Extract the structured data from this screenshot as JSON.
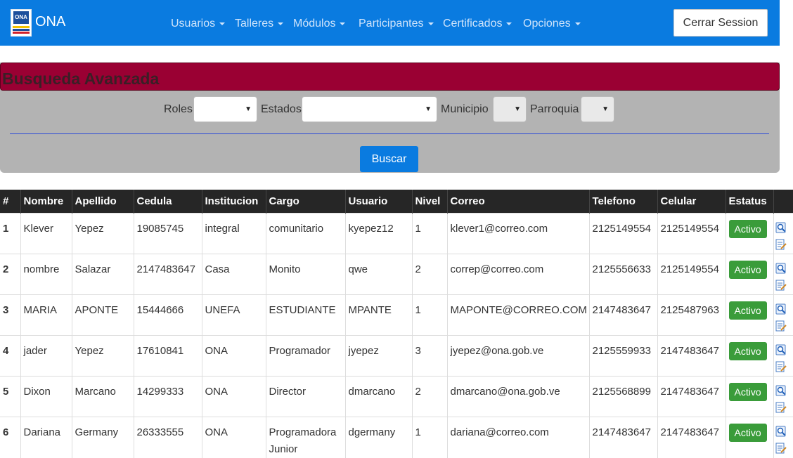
{
  "navbar": {
    "brand": "ONA",
    "logo_text": "ONA",
    "menu": [
      {
        "label": "Usuarios"
      },
      {
        "label": "Talleres"
      },
      {
        "label": "Módulos"
      },
      {
        "label": "Participantes"
      },
      {
        "label": "Certificados"
      },
      {
        "label": "Opciones"
      }
    ],
    "logout_label": "Cerrar Session"
  },
  "search": {
    "title": "Busqueda Avanzada",
    "filters": {
      "roles": "Roles",
      "estados": "Estados",
      "municipio": "Municipio",
      "parroquia": "Parroquia"
    },
    "button": "Buscar"
  },
  "table": {
    "headers": [
      "#",
      "Nombre",
      "Apellido",
      "Cedula",
      "Institucion",
      "Cargo",
      "Usuario",
      "Nivel",
      "Correo",
      "Telefono",
      "Celular",
      "Estatus",
      ""
    ],
    "rows": [
      {
        "n": "1",
        "nombre": "Klever",
        "apellido": "Yepez",
        "cedula": "19085745",
        "institucion": "integral",
        "cargo": "comunitario",
        "usuario": "kyepez12",
        "nivel": "1",
        "correo": "klever1@correo.com",
        "telefono": "2125149554",
        "celular": "2125149554",
        "estatus": "Activo"
      },
      {
        "n": "2",
        "nombre": "nombre",
        "apellido": "Salazar",
        "cedula": "2147483647",
        "institucion": "Casa",
        "cargo": "Monito",
        "usuario": "qwe",
        "nivel": "2",
        "correo": "correp@correo.com",
        "telefono": "2125556633",
        "celular": "2125149554",
        "estatus": "Activo"
      },
      {
        "n": "3",
        "nombre": "MARIA",
        "apellido": "APONTE",
        "cedula": "15444666",
        "institucion": "UNEFA",
        "cargo": "ESTUDIANTE",
        "usuario": "MPANTE",
        "nivel": "1",
        "correo": "MAPONTE@CORREO.COM",
        "telefono": "2147483647",
        "celular": "2125487963",
        "estatus": "Activo"
      },
      {
        "n": "4",
        "nombre": "jader",
        "apellido": "Yepez",
        "cedula": "17610841",
        "institucion": "ONA",
        "cargo": "Programador",
        "usuario": "jyepez",
        "nivel": "3",
        "correo": "jyepez@ona.gob.ve",
        "telefono": "2125559933",
        "celular": "2147483647",
        "estatus": "Activo"
      },
      {
        "n": "5",
        "nombre": "Dixon",
        "apellido": "Marcano",
        "cedula": "14299333",
        "institucion": "ONA",
        "cargo": "Director",
        "usuario": "dmarcano",
        "nivel": "2",
        "correo": "dmarcano@ona.gob.ve",
        "telefono": "2125568899",
        "celular": "2147483647",
        "estatus": "Activo"
      },
      {
        "n": "6",
        "nombre": "Dariana",
        "apellido": "Germany",
        "cedula": "26333555",
        "institucion": "ONA",
        "cargo": "Programadora Junior",
        "usuario": "dgermany",
        "nivel": "1",
        "correo": "dariana@correo.com",
        "telefono": "2147483647",
        "celular": "2147483647",
        "estatus": "Activo"
      }
    ]
  },
  "colors": {
    "navbar": "#0a7be0",
    "panel_header": "#9a0033",
    "panel_body": "#b3b3b3",
    "status_active": "#3a9c3a",
    "table_header": "#262626"
  },
  "icons": {
    "view": "magnifier-icon",
    "edit": "edit-document-icon"
  }
}
